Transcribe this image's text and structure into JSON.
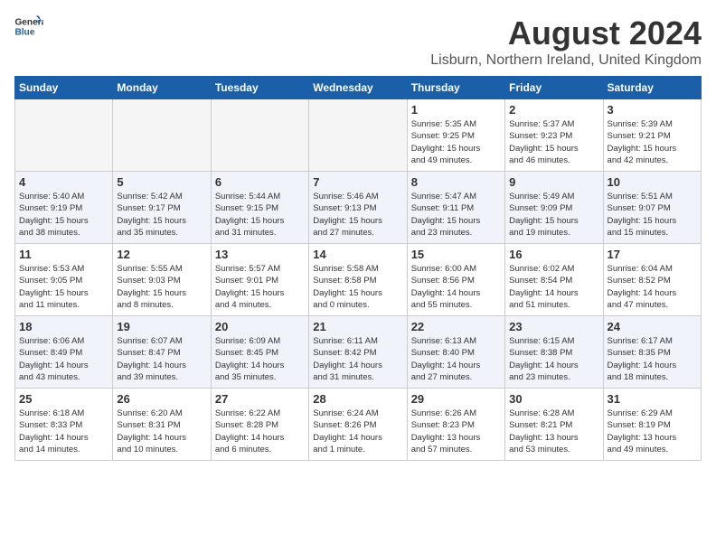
{
  "logo": {
    "line1": "General",
    "line2": "Blue"
  },
  "title": "August 2024",
  "location": "Lisburn, Northern Ireland, United Kingdom",
  "weekdays": [
    "Sunday",
    "Monday",
    "Tuesday",
    "Wednesday",
    "Thursday",
    "Friday",
    "Saturday"
  ],
  "weeks": [
    [
      {
        "num": "",
        "info": ""
      },
      {
        "num": "",
        "info": ""
      },
      {
        "num": "",
        "info": ""
      },
      {
        "num": "",
        "info": ""
      },
      {
        "num": "1",
        "info": "Sunrise: 5:35 AM\nSunset: 9:25 PM\nDaylight: 15 hours\nand 49 minutes."
      },
      {
        "num": "2",
        "info": "Sunrise: 5:37 AM\nSunset: 9:23 PM\nDaylight: 15 hours\nand 46 minutes."
      },
      {
        "num": "3",
        "info": "Sunrise: 5:39 AM\nSunset: 9:21 PM\nDaylight: 15 hours\nand 42 minutes."
      }
    ],
    [
      {
        "num": "4",
        "info": "Sunrise: 5:40 AM\nSunset: 9:19 PM\nDaylight: 15 hours\nand 38 minutes."
      },
      {
        "num": "5",
        "info": "Sunrise: 5:42 AM\nSunset: 9:17 PM\nDaylight: 15 hours\nand 35 minutes."
      },
      {
        "num": "6",
        "info": "Sunrise: 5:44 AM\nSunset: 9:15 PM\nDaylight: 15 hours\nand 31 minutes."
      },
      {
        "num": "7",
        "info": "Sunrise: 5:46 AM\nSunset: 9:13 PM\nDaylight: 15 hours\nand 27 minutes."
      },
      {
        "num": "8",
        "info": "Sunrise: 5:47 AM\nSunset: 9:11 PM\nDaylight: 15 hours\nand 23 minutes."
      },
      {
        "num": "9",
        "info": "Sunrise: 5:49 AM\nSunset: 9:09 PM\nDaylight: 15 hours\nand 19 minutes."
      },
      {
        "num": "10",
        "info": "Sunrise: 5:51 AM\nSunset: 9:07 PM\nDaylight: 15 hours\nand 15 minutes."
      }
    ],
    [
      {
        "num": "11",
        "info": "Sunrise: 5:53 AM\nSunset: 9:05 PM\nDaylight: 15 hours\nand 11 minutes."
      },
      {
        "num": "12",
        "info": "Sunrise: 5:55 AM\nSunset: 9:03 PM\nDaylight: 15 hours\nand 8 minutes."
      },
      {
        "num": "13",
        "info": "Sunrise: 5:57 AM\nSunset: 9:01 PM\nDaylight: 15 hours\nand 4 minutes."
      },
      {
        "num": "14",
        "info": "Sunrise: 5:58 AM\nSunset: 8:58 PM\nDaylight: 15 hours\nand 0 minutes."
      },
      {
        "num": "15",
        "info": "Sunrise: 6:00 AM\nSunset: 8:56 PM\nDaylight: 14 hours\nand 55 minutes."
      },
      {
        "num": "16",
        "info": "Sunrise: 6:02 AM\nSunset: 8:54 PM\nDaylight: 14 hours\nand 51 minutes."
      },
      {
        "num": "17",
        "info": "Sunrise: 6:04 AM\nSunset: 8:52 PM\nDaylight: 14 hours\nand 47 minutes."
      }
    ],
    [
      {
        "num": "18",
        "info": "Sunrise: 6:06 AM\nSunset: 8:49 PM\nDaylight: 14 hours\nand 43 minutes."
      },
      {
        "num": "19",
        "info": "Sunrise: 6:07 AM\nSunset: 8:47 PM\nDaylight: 14 hours\nand 39 minutes."
      },
      {
        "num": "20",
        "info": "Sunrise: 6:09 AM\nSunset: 8:45 PM\nDaylight: 14 hours\nand 35 minutes."
      },
      {
        "num": "21",
        "info": "Sunrise: 6:11 AM\nSunset: 8:42 PM\nDaylight: 14 hours\nand 31 minutes."
      },
      {
        "num": "22",
        "info": "Sunrise: 6:13 AM\nSunset: 8:40 PM\nDaylight: 14 hours\nand 27 minutes."
      },
      {
        "num": "23",
        "info": "Sunrise: 6:15 AM\nSunset: 8:38 PM\nDaylight: 14 hours\nand 23 minutes."
      },
      {
        "num": "24",
        "info": "Sunrise: 6:17 AM\nSunset: 8:35 PM\nDaylight: 14 hours\nand 18 minutes."
      }
    ],
    [
      {
        "num": "25",
        "info": "Sunrise: 6:18 AM\nSunset: 8:33 PM\nDaylight: 14 hours\nand 14 minutes."
      },
      {
        "num": "26",
        "info": "Sunrise: 6:20 AM\nSunset: 8:31 PM\nDaylight: 14 hours\nand 10 minutes."
      },
      {
        "num": "27",
        "info": "Sunrise: 6:22 AM\nSunset: 8:28 PM\nDaylight: 14 hours\nand 6 minutes."
      },
      {
        "num": "28",
        "info": "Sunrise: 6:24 AM\nSunset: 8:26 PM\nDaylight: 14 hours\nand 1 minute."
      },
      {
        "num": "29",
        "info": "Sunrise: 6:26 AM\nSunset: 8:23 PM\nDaylight: 13 hours\nand 57 minutes."
      },
      {
        "num": "30",
        "info": "Sunrise: 6:28 AM\nSunset: 8:21 PM\nDaylight: 13 hours\nand 53 minutes."
      },
      {
        "num": "31",
        "info": "Sunrise: 6:29 AM\nSunset: 8:19 PM\nDaylight: 13 hours\nand 49 minutes."
      }
    ]
  ]
}
